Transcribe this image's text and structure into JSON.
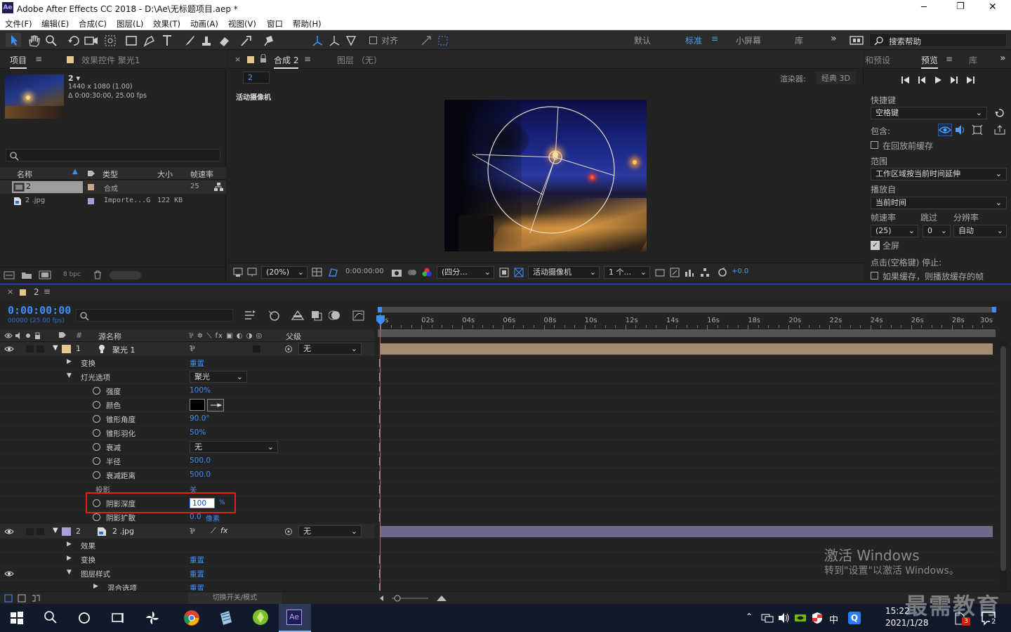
{
  "window": {
    "app_badge": "Ae",
    "title": "Adobe After Effects CC 2018 - D:\\Ae\\无标题项目.aep *",
    "min": "─",
    "max": "❐",
    "close": "✕"
  },
  "menu": [
    "文件(F)",
    "编辑(E)",
    "合成(C)",
    "图层(L)",
    "效果(T)",
    "动画(A)",
    "视图(V)",
    "窗口",
    "帮助(H)"
  ],
  "toolbar": {
    "align_label": "对齐",
    "workspaces": [
      "默认",
      "标准",
      "小屏幕",
      "库"
    ],
    "active_workspace": "标准",
    "more": "»",
    "search_placeholder": "搜索帮助"
  },
  "project": {
    "tab_project": "项目",
    "tab_effects": "效果控件 聚光1",
    "thumb_name": "2 ▾",
    "thumb_info1": "1440 x 1080 (1.00)",
    "thumb_info2": "Δ 0:00:30:00, 25.00 fps",
    "search_icon": "search-icon",
    "cols": [
      "名称",
      "类型",
      "大小",
      "帧速率"
    ],
    "items": [
      {
        "name": "2",
        "type": "合成",
        "size": "",
        "fps": "25",
        "selected": true
      },
      {
        "name": "2 .jpg",
        "type": "Importe...G",
        "size": "122 KB",
        "fps": ""
      }
    ],
    "bpc": "8 bpc"
  },
  "comp": {
    "tab": "合成 2",
    "layer_tab": "图层 （无）",
    "breadcrumb": "2",
    "renderer_label": "渲染器:",
    "renderer": "经典 3D",
    "camera_label": "活动摄像机",
    "zoom": "(20%)",
    "timecode": "0:00:00:00",
    "resolution": "(四分...",
    "camera": "活动摄像机",
    "views": "1 个...",
    "exposure": "+0.0"
  },
  "preview": {
    "tab_info": "和预设",
    "tab_preview": "预览",
    "tab_lib": "库",
    "shortcut_label": "快捷键",
    "shortcut": "空格键",
    "include_label": "包含:",
    "cache_before": "在回放前缓存",
    "range_label": "范围",
    "range": "工作区域按当前时间延伸",
    "play_from_label": "播放自",
    "play_from": "当前时间",
    "fps_label": "帧速率",
    "skip_label": "跳过",
    "res_label": "分辨率",
    "fps": "(25)",
    "skip": "0",
    "res": "自动",
    "fullscreen": "全屏",
    "stop_label": "点击(空格键) 停止:",
    "cache_note": "如果缓存，则播放缓存的帧"
  },
  "timeline": {
    "tab": "2",
    "timecode": "0:00:00:00",
    "frames": "00000 (25.00 fps)",
    "col_source": "源名称",
    "col_parent": "父级",
    "ruler": [
      "0s",
      "02s",
      "04s",
      "06s",
      "08s",
      "10s",
      "12s",
      "14s",
      "16s",
      "18s",
      "20s",
      "22s",
      "24s",
      "26s",
      "28s",
      "30s"
    ],
    "rows": [
      {
        "indent": 0,
        "num": "1",
        "name": "聚光 1",
        "kind": "layer",
        "parent": "无",
        "value": ""
      },
      {
        "indent": 1,
        "name": "变换",
        "kind": "group",
        "value": "重置"
      },
      {
        "indent": 1,
        "name": "灯光选项",
        "kind": "group-open",
        "value": "聚光"
      },
      {
        "indent": 2,
        "name": "强度",
        "kind": "prop",
        "value": "100%"
      },
      {
        "indent": 2,
        "name": "颜色",
        "kind": "color",
        "value": ""
      },
      {
        "indent": 2,
        "name": "锥形角度",
        "kind": "prop",
        "value": "90.0°"
      },
      {
        "indent": 2,
        "name": "锥形羽化",
        "kind": "prop",
        "value": "50%"
      },
      {
        "indent": 2,
        "name": "衰减",
        "kind": "dropdown",
        "value": "无"
      },
      {
        "indent": 2,
        "name": "半径",
        "kind": "prop",
        "value": "500.0"
      },
      {
        "indent": 2,
        "name": "衰减距离",
        "kind": "prop",
        "value": "500.0"
      },
      {
        "indent": 2,
        "name": "投影",
        "kind": "nostop",
        "value": "关"
      },
      {
        "indent": 2,
        "name": "阴影深度",
        "kind": "editing",
        "value": "100",
        "unit": "%"
      },
      {
        "indent": 2,
        "name": "阴影扩散",
        "kind": "prop",
        "value": "0.0",
        "unit": "像素"
      },
      {
        "indent": 0,
        "num": "2",
        "name": "2 .jpg",
        "kind": "layer2",
        "parent": "无",
        "value": ""
      },
      {
        "indent": 1,
        "name": "效果",
        "kind": "group",
        "value": ""
      },
      {
        "indent": 1,
        "name": "变换",
        "kind": "group",
        "value": "重置"
      },
      {
        "indent": 1,
        "name": "图层样式",
        "kind": "group-open",
        "value": "重置"
      },
      {
        "indent": 2,
        "name": "混合选项",
        "kind": "group",
        "value": "重置"
      }
    ],
    "toggle_label": "切换开关/模式"
  },
  "watermark": {
    "line1": "激活 Windows",
    "line2": "转到\"设置\"以激活 Windows。",
    "brand": "最需教育"
  },
  "taskbar": {
    "time": "15:22",
    "date": "2021/1/28",
    "ime": "中",
    "badge": "3",
    "notif": "2"
  }
}
